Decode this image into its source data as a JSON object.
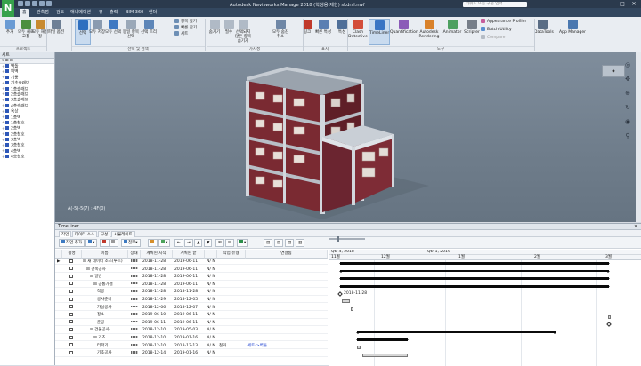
{
  "app": {
    "title": "Autodesk Navisworks Manage 2018 (학생용 제한)    skdrsl.nwf",
    "search_placeholder": "키워드 또는 구문 입력"
  },
  "tabs": [
    "홈",
    "관측점",
    "검토",
    "애니메이션",
    "뷰",
    "출력",
    "BIM 360",
    "렌더"
  ],
  "ribbon": {
    "buttons": [
      {
        "label": "추가",
        "color": "#6a9bd4"
      },
      {
        "label": "모두 새로 고침",
        "color": "#4c8f3f"
      },
      {
        "label": "모두 재설정",
        "color": "#c88a2f"
      },
      {
        "label": "파일 옵션",
        "color": "#6d7f95"
      },
      {
        "label": "선택",
        "color": "#2f6fbf"
      },
      {
        "label": "모두 저장",
        "color": "#8a9bb0"
      },
      {
        "label": "모두 선택",
        "color": "#3f79c2"
      },
      {
        "label": "동일 항목 선택",
        "color": "#9aa8b8"
      },
      {
        "label": "선택 트리",
        "color": "#5d86b8"
      },
      {
        "label": "숨기기",
        "color": "#b0bac6"
      },
      {
        "label": "필수",
        "color": "#b0bac6"
      },
      {
        "label": "선택되지 않은 항목 숨기기",
        "color": "#b0bac6"
      },
      {
        "label": "모두 숨김 취소",
        "color": "#6f87a6"
      },
      {
        "label": "링크",
        "color": "#c0392b"
      },
      {
        "label": "빠른 특성",
        "color": "#5b7fb2"
      },
      {
        "label": "특성",
        "color": "#4f6f99"
      },
      {
        "label": "Clash Detective",
        "color": "#d34d3a"
      },
      {
        "label": "TimeLiner",
        "color": "#3a75c4"
      },
      {
        "label": "Quantification",
        "color": "#8b5bb8"
      },
      {
        "label": "Autodesk Rendering",
        "color": "#d9822b"
      },
      {
        "label": "Animator",
        "color": "#4da061"
      },
      {
        "label": "Scripter",
        "color": "#777f8a"
      },
      {
        "label": "DataTools",
        "color": "#5a6d85"
      },
      {
        "label": "App Manager",
        "color": "#4a78b0"
      }
    ],
    "small": {
      "find": "항목 찾기",
      "quick_find": "빠른 찾기",
      "set": "세트",
      "appearance": "Appearance Profiler",
      "batch": "Batch Utility",
      "compare": "Compare"
    },
    "groups": [
      "프로젝트",
      "선택 및 검색",
      "가시성",
      "표시",
      "도구"
    ]
  },
  "tree": {
    "title": "세트",
    "items": [
      {
        "label": "벽돌",
        "expanded": false
      },
      {
        "label": "외벽",
        "expanded": false
      },
      {
        "label": "기둥",
        "expanded": false
      },
      {
        "label": "기초슬래브",
        "expanded": false
      },
      {
        "label": "1층슬래브",
        "expanded": false
      },
      {
        "label": "2층슬래브",
        "expanded": false
      },
      {
        "label": "3층슬래브",
        "expanded": false
      },
      {
        "label": "4층슬래브",
        "expanded": false
      },
      {
        "label": "옥상",
        "expanded": false
      },
      {
        "label": "1층벽",
        "expanded": false
      },
      {
        "label": "1층창호",
        "expanded": false
      },
      {
        "label": "2층벽",
        "expanded": false
      },
      {
        "label": "2층창호",
        "expanded": false
      },
      {
        "label": "3층벽",
        "expanded": false
      },
      {
        "label": "3층창호",
        "expanded": false
      },
      {
        "label": "4층벽",
        "expanded": false
      },
      {
        "label": "4층창호",
        "expanded": false
      }
    ]
  },
  "viewport": {
    "coords": "A(-5)-5(7) : 4F(0)"
  },
  "timeliner": {
    "title": "TimeLiner",
    "tabs": [
      "작업",
      "데이터 소스",
      "구성",
      "시뮬레이트"
    ],
    "toolbar": [
      "작업 추가",
      "",
      "",
      "",
      "",
      "",
      ""
    ],
    "columns": [
      "활성",
      "이름",
      "상태",
      "계획된 시작",
      "계획된 끝",
      "",
      "작업 유형",
      "연결됨"
    ],
    "rows": [
      {
        "name": "새 데이터 소스(루트)",
        "indent": 0,
        "start": "2018-11-28",
        "end": "2019-06-11",
        "flags": "N/ N",
        "type": "",
        "linked": ""
      },
      {
        "name": "건축공사",
        "indent": 1,
        "start": "2018-11-28",
        "end": "2019-06-11",
        "flags": "N/ N",
        "type": "",
        "linked": ""
      },
      {
        "name": "일반",
        "indent": 2,
        "start": "2018-11-28",
        "end": "2019-06-11",
        "flags": "N/ N",
        "type": "",
        "linked": ""
      },
      {
        "name": "공통가설",
        "indent": 3,
        "start": "2018-11-28",
        "end": "2019-06-11",
        "flags": "N/ N",
        "type": "",
        "linked": ""
      },
      {
        "name": "착공",
        "indent": 4,
        "start": "2018-11-28",
        "end": "2018-11-28",
        "flags": "N/ N",
        "type": "",
        "linked": ""
      },
      {
        "name": "공사준비",
        "indent": 4,
        "start": "2018-11-29",
        "end": "2018-12-05",
        "flags": "N/ N",
        "type": "",
        "linked": ""
      },
      {
        "name": "가설공사",
        "indent": 4,
        "start": "2018-12-06",
        "end": "2018-12-07",
        "flags": "N/ N",
        "type": "",
        "linked": ""
      },
      {
        "name": "정소",
        "indent": 4,
        "start": "2019-06-10",
        "end": "2019-06-11",
        "flags": "N/ N",
        "type": "",
        "linked": ""
      },
      {
        "name": "준공",
        "indent": 4,
        "start": "2019-06-11",
        "end": "2019-06-11",
        "flags": "N/ N",
        "type": "",
        "linked": ""
      },
      {
        "name": "건물공사",
        "indent": 2,
        "start": "2018-12-10",
        "end": "2019-05-03",
        "flags": "N/ N",
        "type": "",
        "linked": ""
      },
      {
        "name": "기초",
        "indent": 3,
        "start": "2018-12-10",
        "end": "2019-01-16",
        "flags": "N/ N",
        "type": "",
        "linked": ""
      },
      {
        "name": "터파기",
        "indent": 4,
        "start": "2018-12-10",
        "end": "2018-12-13",
        "flags": "N/ N",
        "type": "철거",
        "linked": "세트->벽돌"
      },
      {
        "name": "기초공사",
        "indent": 4,
        "start": "2018-12-14",
        "end": "2019-01-16",
        "flags": "N/ N",
        "type": "",
        "linked": ""
      }
    ],
    "gantt": {
      "quarters": [
        "Qtr 4, 2018",
        "Qtr 1, 2019"
      ],
      "months": [
        "11월",
        "12월",
        "1월",
        "2월",
        "3월"
      ],
      "milestone_label": "2018-11-28"
    }
  }
}
